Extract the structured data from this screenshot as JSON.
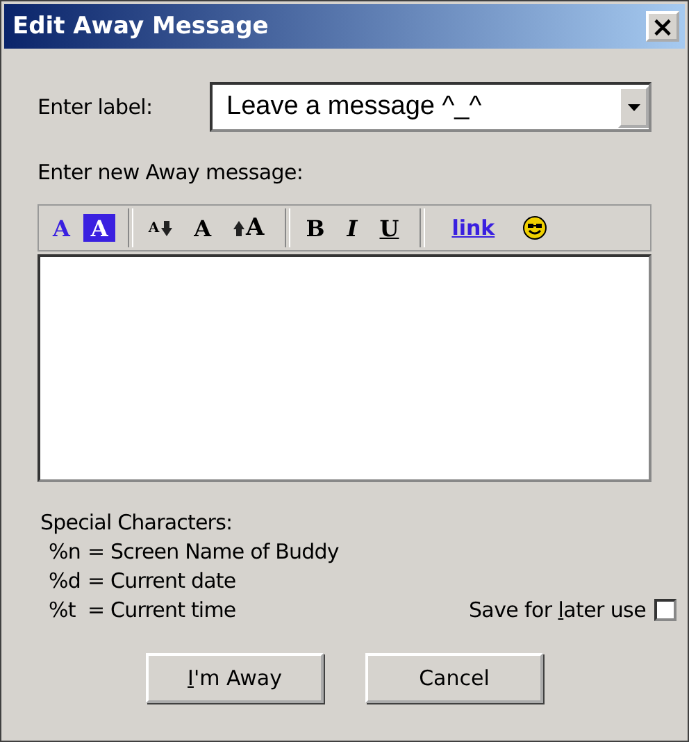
{
  "window": {
    "title": "Edit Away Message",
    "close": "×"
  },
  "label_field": {
    "label": "Enter label:",
    "value": "Leave a message ^_^"
  },
  "message_label": "Enter new Away message:",
  "toolbar": [
    [
      {
        "kind": "fg",
        "label": "A"
      },
      {
        "kind": "bg",
        "label": "A"
      }
    ],
    [
      {
        "kind": "smaller",
        "label": "A"
      },
      {
        "kind": "normal",
        "label": "A"
      },
      {
        "kind": "larger",
        "label": "A"
      }
    ],
    [
      {
        "kind": "bold",
        "label": "B"
      },
      {
        "kind": "italic",
        "label": "I"
      },
      {
        "kind": "underline",
        "label": "U"
      }
    ],
    [
      {
        "kind": "link",
        "label": "link"
      },
      {
        "kind": "smiley"
      }
    ]
  ],
  "special": {
    "title": "Special Characters:",
    "items": [
      {
        "code": "%n",
        "meaning": "= Screen Name of Buddy"
      },
      {
        "code": "%d",
        "meaning": "= Current date"
      },
      {
        "code": "%t",
        "meaning": "= Current time"
      }
    ]
  },
  "save": {
    "label": [
      {
        "text": "Save for ",
        "underlined": false
      },
      {
        "text": "l",
        "underlined": true
      },
      {
        "text": "ater use",
        "underlined": false
      }
    ],
    "checked": false
  },
  "buttons": [
    {
      "label": [
        {
          "text": "I",
          "underlined": true
        },
        {
          "text": "'m Away",
          "underlined": false
        }
      ]
    },
    {
      "label": [
        {
          "text": "Cancel",
          "underlined": false
        }
      ]
    }
  ]
}
